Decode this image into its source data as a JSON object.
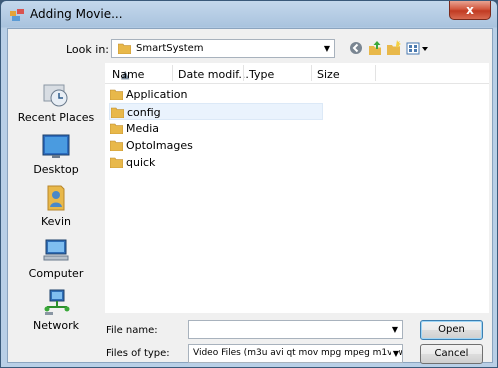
{
  "window": {
    "title": "Adding Movie...",
    "close_glyph": "x"
  },
  "lookin": {
    "label": "Look in:",
    "value": "SmartSystem"
  },
  "toolbar": {
    "icons": [
      "back-icon",
      "up-folder-icon",
      "new-folder-icon",
      "views-menu-icon"
    ]
  },
  "places": [
    {
      "label": "Recent Places",
      "icon": "recent-places-icon"
    },
    {
      "label": "Desktop",
      "icon": "desktop-icon"
    },
    {
      "label": "Kevin",
      "icon": "user-folder-icon"
    },
    {
      "label": "Computer",
      "icon": "computer-icon"
    },
    {
      "label": "Network",
      "icon": "network-icon"
    }
  ],
  "columns": [
    "Name",
    "Date modif...",
    "Type",
    "Size"
  ],
  "files": [
    {
      "name": "Application"
    },
    {
      "name": "config"
    },
    {
      "name": "Media"
    },
    {
      "name": "OptoImages"
    },
    {
      "name": "quick"
    }
  ],
  "filename": {
    "label": "File name:",
    "value": ""
  },
  "filetype": {
    "label": "Files of type:",
    "value": "Video Files (m3u avi qt mov mpg mpeg m1v wm"
  },
  "buttons": {
    "open": "Open",
    "cancel": "Cancel"
  },
  "colors": {
    "folder": "#e8b84a",
    "title_bar": "#b9cfe6",
    "close": "#c7442b"
  }
}
